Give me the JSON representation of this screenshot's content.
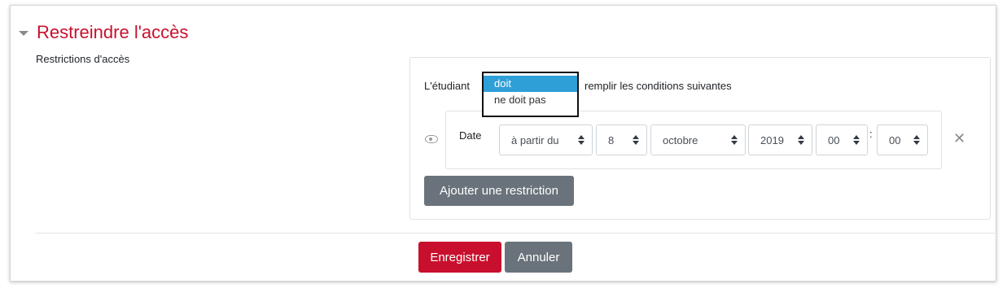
{
  "section": {
    "title": "Restreindre l'accès",
    "field_label": "Restrictions d'accès"
  },
  "condition": {
    "prefix": "L'étudiant",
    "suffix": "remplir les conditions suivantes",
    "options": [
      "doit",
      "ne doit pas"
    ],
    "selected": "doit"
  },
  "date_restriction": {
    "label": "Date",
    "direction": "à partir du",
    "day": "8",
    "month": "octobre",
    "year": "2019",
    "hour": "00",
    "minute": "00",
    "separator": ":"
  },
  "icons": {
    "visibility": "eye-icon",
    "remove": "close-icon",
    "toggle": "caret-down-icon"
  },
  "buttons": {
    "add_restriction": "Ajouter une restriction",
    "save": "Enregistrer",
    "cancel": "Annuler"
  },
  "colors": {
    "brand": "#c8102e",
    "secondary": "#6a737b",
    "selection": "#2f9fd8"
  }
}
